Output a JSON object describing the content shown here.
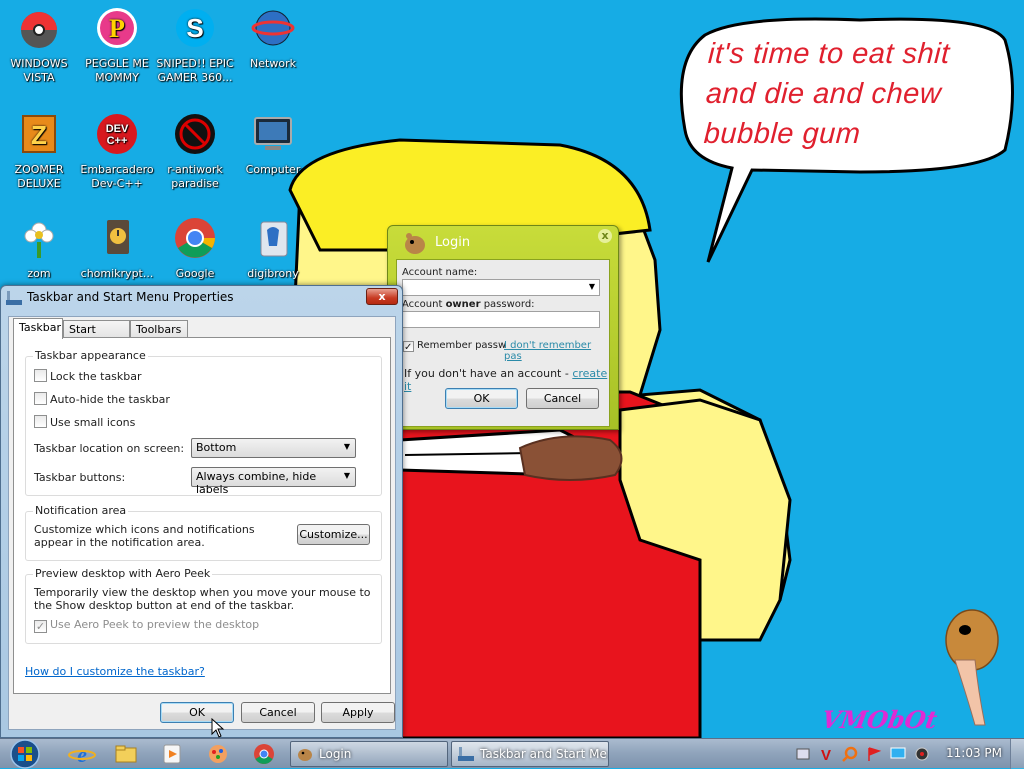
{
  "desktop": {
    "icons": [
      {
        "label": "WINDOWS VISTA",
        "icon": "pokeball-icon"
      },
      {
        "label": "PEGGLE ME MOMMY",
        "icon": "peggle-icon"
      },
      {
        "label": "SNIPED!! EPIC GAMER 360...",
        "icon": "skype-icon"
      },
      {
        "label": "Network",
        "icon": "network-globe-icon"
      },
      {
        "label": "ZOOMER DELUXE",
        "icon": "zuma-icon"
      },
      {
        "label": "Embarcadero Dev-C++",
        "icon": "devcpp-icon"
      },
      {
        "label": "r-antiwork paradise",
        "icon": "antiwork-icon"
      },
      {
        "label": "Computer",
        "icon": "computer-icon"
      },
      {
        "label": "zom",
        "icon": "flower-icon"
      },
      {
        "label": "chomikrypt...",
        "icon": "clock-file-icon"
      },
      {
        "label": "Google",
        "icon": "chrome-icon"
      },
      {
        "label": "digibrony",
        "icon": "digibrony-icon"
      }
    ],
    "bubble_text": "it's time to eat shit and die and chew bubble gum",
    "watermark": "VMObOt"
  },
  "taskbar_props": {
    "title": "Taskbar and Start Menu Properties",
    "close": "x",
    "tabs": [
      "Taskbar",
      "Start Menu",
      "Toolbars"
    ],
    "appearance": {
      "title": "Taskbar appearance",
      "lock": "Lock the taskbar",
      "autohide": "Auto-hide the taskbar",
      "small_icons": "Use small icons",
      "location_label": "Taskbar location on screen:",
      "location_value": "Bottom",
      "buttons_label": "Taskbar buttons:",
      "buttons_value": "Always combine, hide labels"
    },
    "notification": {
      "title": "Notification area",
      "text": "Customize which icons and notifications appear in the notification area.",
      "customize": "Customize..."
    },
    "peek": {
      "title": "Preview desktop with Aero Peek",
      "text": "Temporarily view the desktop when you move your mouse to the Show desktop button at end of the taskbar.",
      "use": "Use Aero Peek to preview the desktop"
    },
    "help_link": "How do I customize the taskbar?",
    "ok": "OK",
    "cancel": "Cancel",
    "apply": "Apply"
  },
  "login": {
    "title": "Login",
    "account_label": "Account name:",
    "password_label_pre": "Account ",
    "password_label_bold": "owner",
    "password_label_post": " password:",
    "remember": "Remember passw",
    "forgot": "I don't remember pas",
    "no_account": "If you don't have an account - ",
    "create": "create it",
    "ok": "OK",
    "cancel": "Cancel"
  },
  "taskbar": {
    "tasks": [
      {
        "label": "Login"
      },
      {
        "label": "Taskbar and Start Me..."
      }
    ],
    "clock": "11:03 PM"
  }
}
